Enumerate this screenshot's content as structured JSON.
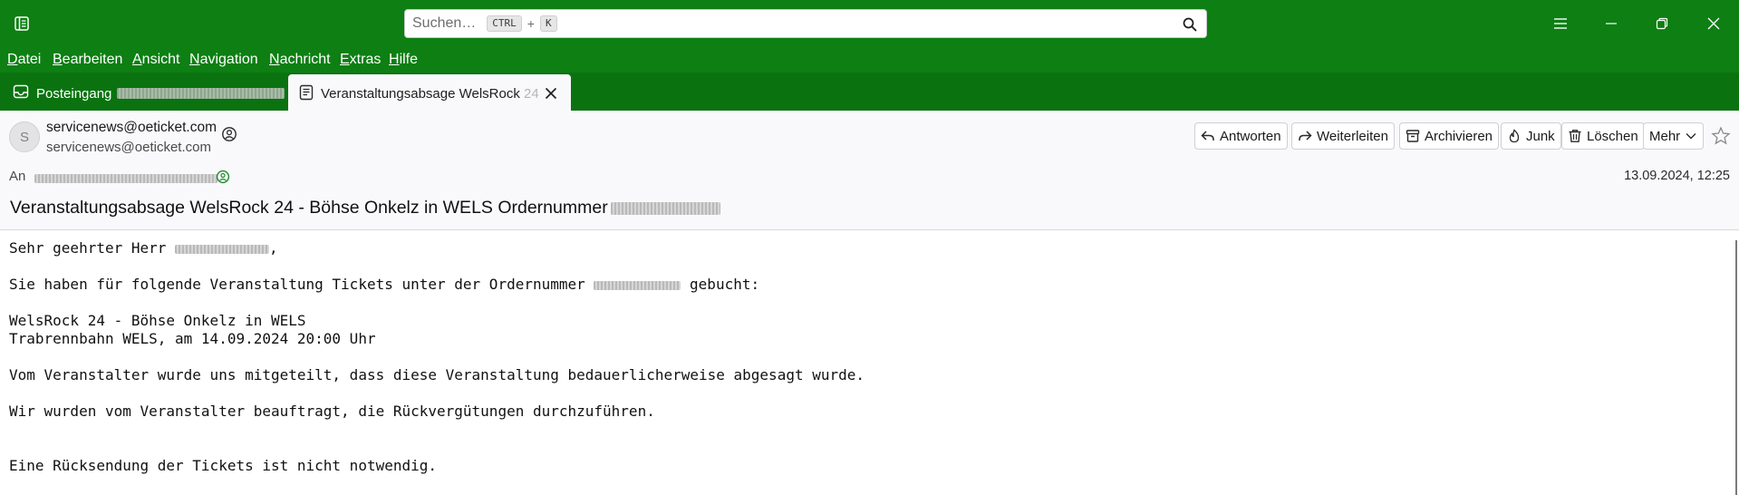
{
  "colors": {
    "titlebar": "#0d7f13",
    "tabstrip": "#0a7310",
    "header_bg": "#f9f9fb"
  },
  "titlebar": {
    "search_placeholder": "Suchen…",
    "shortcut_key1": "CTRL",
    "shortcut_plus": "+",
    "shortcut_key2": "K"
  },
  "menubar": {
    "items": [
      "Datei",
      "Bearbeiten",
      "Ansicht",
      "Navigation",
      "Nachricht",
      "Extras",
      "Hilfe"
    ]
  },
  "tabs": {
    "inbox": {
      "label": "Posteingang",
      "icon": "inbox-icon"
    },
    "message": {
      "label": "Veranstaltungsabsage WelsRock",
      "label_fade": "24",
      "icon": "message-icon"
    }
  },
  "header": {
    "avatar_letter": "S",
    "from_name": "servicenews@oeticket.com",
    "from_email": "servicenews@oeticket.com",
    "to_label": "An",
    "date": "13.09.2024, 12:25",
    "subject": "Veranstaltungsabsage WelsRock 24 - Böhse Onkelz in WELS Ordernummer",
    "actions": {
      "reply": "Antworten",
      "forward": "Weiterleiten",
      "archive": "Archivieren",
      "junk": "Junk",
      "delete": "Löschen",
      "more": "Mehr"
    }
  },
  "body": {
    "greeting_pre": "Sehr geehrter Herr ",
    "greeting_post": ",",
    "line2_pre": "Sie haben für folgende Veranstaltung Tickets unter der Ordernummer ",
    "line2_post": " gebucht:",
    "event_line1": "WelsRock 24 - Böhse Onkelz in WELS",
    "event_line2": "Trabrennbahn WELS, am 14.09.2024 20:00 Uhr",
    "line3": "Vom Veranstalter wurde uns mitgeteilt, dass diese Veranstaltung bedauerlicherweise abgesagt wurde.",
    "line4": "Wir wurden vom Veranstalter beauftragt, die Rückvergütungen durchzuführen.",
    "line5": "Eine Rücksendung der Tickets ist nicht notwendig."
  }
}
